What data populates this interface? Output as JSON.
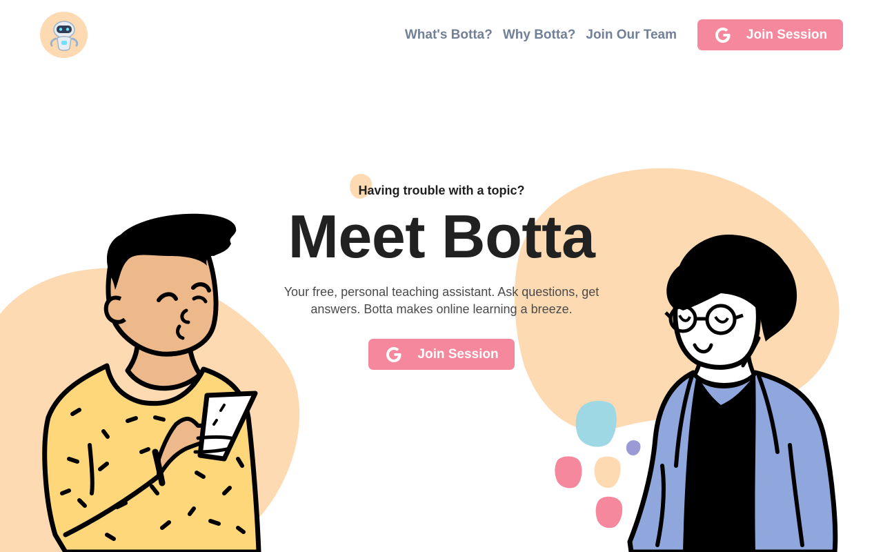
{
  "header": {
    "logo_name": "botta-robot-logo",
    "nav": [
      {
        "label": "What's Botta?"
      },
      {
        "label": "Why Botta?"
      },
      {
        "label": "Join Our Team"
      }
    ],
    "join_button_label": "Join Session"
  },
  "hero": {
    "tagline": "Having trouble with a topic?",
    "headline": "Meet Botta",
    "subtitle": "Your free, personal teaching assistant. Ask questions, get answers. Botta makes online learning a breeze.",
    "join_button_label": "Join Session"
  },
  "colors": {
    "accent_pink": "#f6889d",
    "peach": "#fddab2",
    "nav_gray": "#718096",
    "headline": "#212121",
    "blue_jacket": "#8fa7dc",
    "light_blue": "#9ed8e4",
    "lavender": "#9a9ad6",
    "yellow_shirt": "#fed77a",
    "skin": "#edb98a"
  },
  "icons": {
    "google": "google-g-icon",
    "logo": "robot-icon"
  }
}
